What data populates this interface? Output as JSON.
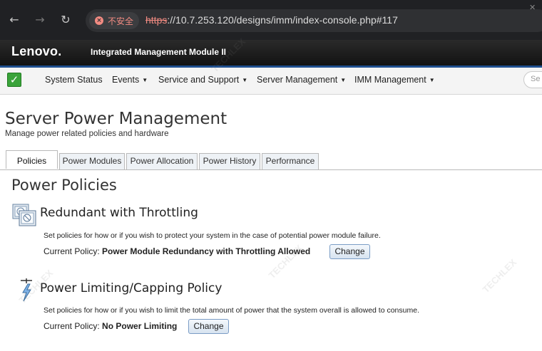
{
  "browser": {
    "security_label": "不安全",
    "url_scheme": "https",
    "url_rest": "://10.7.253.120/designs/imm/index-console.php#117"
  },
  "header": {
    "brand": "Lenovo.",
    "product": "Integrated Management Module II"
  },
  "menu": {
    "items": [
      {
        "label": "System Status"
      },
      {
        "label": "Events"
      },
      {
        "label": "Service and Support"
      },
      {
        "label": "Server Management"
      },
      {
        "label": "IMM Management"
      }
    ],
    "search_placeholder": "Se"
  },
  "page": {
    "title": "Server Power Management",
    "subtitle": "Manage power related policies and hardware"
  },
  "tabs": [
    {
      "label": "Policies",
      "active": true
    },
    {
      "label": "Power Modules"
    },
    {
      "label": "Power Allocation"
    },
    {
      "label": "Power History"
    },
    {
      "label": "Performance"
    }
  ],
  "content": {
    "heading": "Power Policies",
    "redundant": {
      "title": "Redundant with Throttling",
      "description": "Set policies for how or if you wish to protect your system in the case of potential power module failure.",
      "current_label": "Current Policy:",
      "current_value": "Power Module Redundancy with Throttling Allowed",
      "button": "Change"
    },
    "capping": {
      "title": "Power Limiting/Capping Policy",
      "description": "Set policies for how or if you wish to limit the total amount of power that the system overall is allowed to consume.",
      "current_label": "Current Policy:",
      "current_value": "No Power Limiting",
      "button": "Change"
    }
  },
  "watermark": "TECHLEX",
  "colors": {
    "header_bg": "#1a1a1a",
    "accent": "#1f4f8f",
    "status_ok": "#3aa33a",
    "insecure": "#f28b82"
  }
}
